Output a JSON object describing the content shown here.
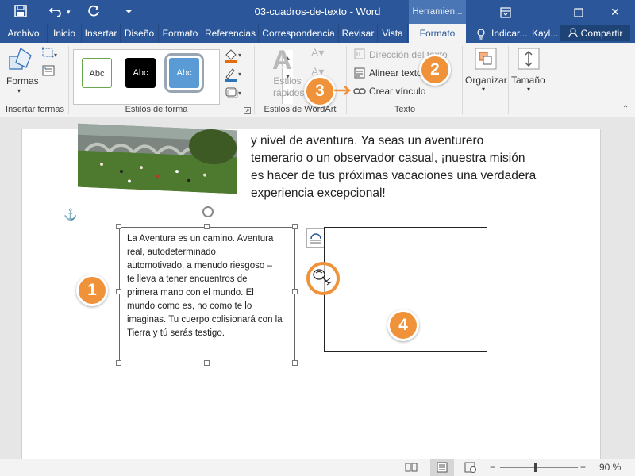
{
  "titlebar": {
    "doc_title": "03-cuadros-de-texto - Word",
    "context_tab_title": "Herramien...",
    "accent_color": "#2b579a"
  },
  "tabs": [
    {
      "label": "Archivo"
    },
    {
      "label": "Inicio"
    },
    {
      "label": "Insertar"
    },
    {
      "label": "Diseño"
    },
    {
      "label": "Formato"
    },
    {
      "label": "Referencias"
    },
    {
      "label": "Correspondencia"
    },
    {
      "label": "Revisar"
    },
    {
      "label": "Vista"
    },
    {
      "label": "Formato",
      "active": true
    }
  ],
  "tab_right": {
    "tell_me": "Indicar...",
    "user": "Kayl...",
    "share": "Compartir"
  },
  "ribbon": {
    "shapes_label": "Formas",
    "group_insert_shapes": "Insertar formas",
    "style_samples": [
      "Abc",
      "Abc",
      "Abc"
    ],
    "group_shape_styles": "Estilos de forma",
    "wordart_quick_styles": "Estilos rápidos",
    "group_wordart": "Estilos de WordArt",
    "text_direction": "Dirección del texto",
    "align_text": "Alinear texto",
    "create_link": "Crear vínculo",
    "group_text": "Texto",
    "arrange": "Organizar",
    "size": "Tamaño"
  },
  "document": {
    "para_lines": [
      "y nivel de aventura. Ya seas un aventurero",
      "temerario o un observador casual, ¡nuestra misión",
      "es hacer de tus próximas vacaciones una verdadera",
      "experiencia excepcional!"
    ],
    "textbox_lines": [
      "La Aventura es un camino. Aventura",
      "real, autodeterminado,",
      "automotivado, a menudo riesgoso –",
      "te lleva a tener encuentros de",
      "primera mano con el mundo. El",
      "mundo como es, no como te lo",
      "imaginas. Tu cuerpo colisionará con la",
      "Tierra y tú serás testigo."
    ]
  },
  "callouts": [
    "1",
    "2",
    "3",
    "4"
  ],
  "callout_color": "#f0923a",
  "statusbar": {
    "zoom": "90 %"
  }
}
